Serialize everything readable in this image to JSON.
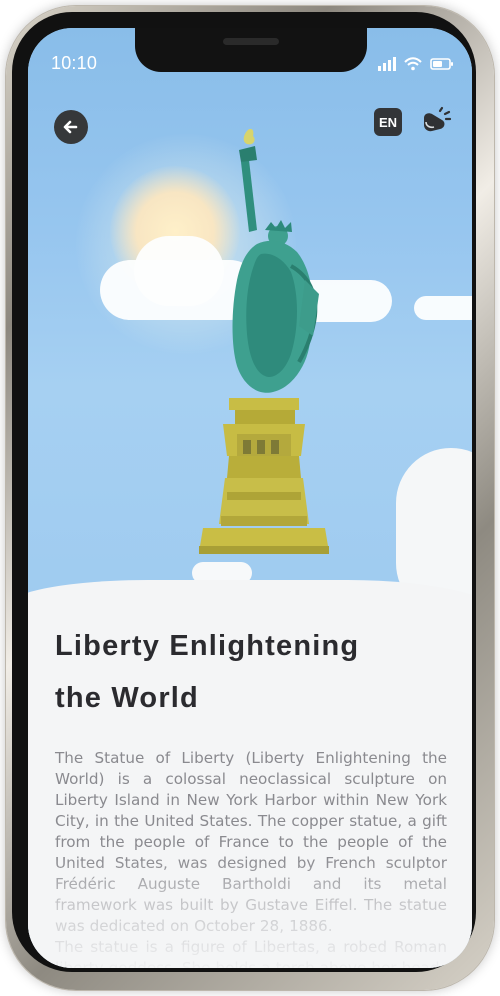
{
  "status_bar": {
    "time": "10:10",
    "icons": [
      "signal-icon",
      "wifi-icon",
      "battery-icon"
    ]
  },
  "header": {
    "back_icon": "arrow-left-icon",
    "language_label": "EN",
    "speaker_icon": "speaker-icon"
  },
  "article": {
    "title_line_1": "Liberty Enlightening",
    "title_line_2": "the World",
    "paragraph_1": "The Statue of Liberty (Liberty Enlightening the World) is a colossal neoclassical sculpture on Liberty Island in New York Harbor within New York City, in the United States. The copper statue, a gift from the people of France to the people of the United States, was designed by French sculptor Frédéric Auguste Bartholdi and its metal framework was built by Gustave Eiffel. The statue was dedicated on October 28, 1886.",
    "paragraph_2": "The statue is a figure of Libertas, a robed Roman liberty goddess. She holds a torch above her head"
  },
  "colors": {
    "sky": "#9fcaee",
    "title": "#2b2b2f",
    "body_text": "#8a8a8f",
    "button_dark": "#333538"
  }
}
